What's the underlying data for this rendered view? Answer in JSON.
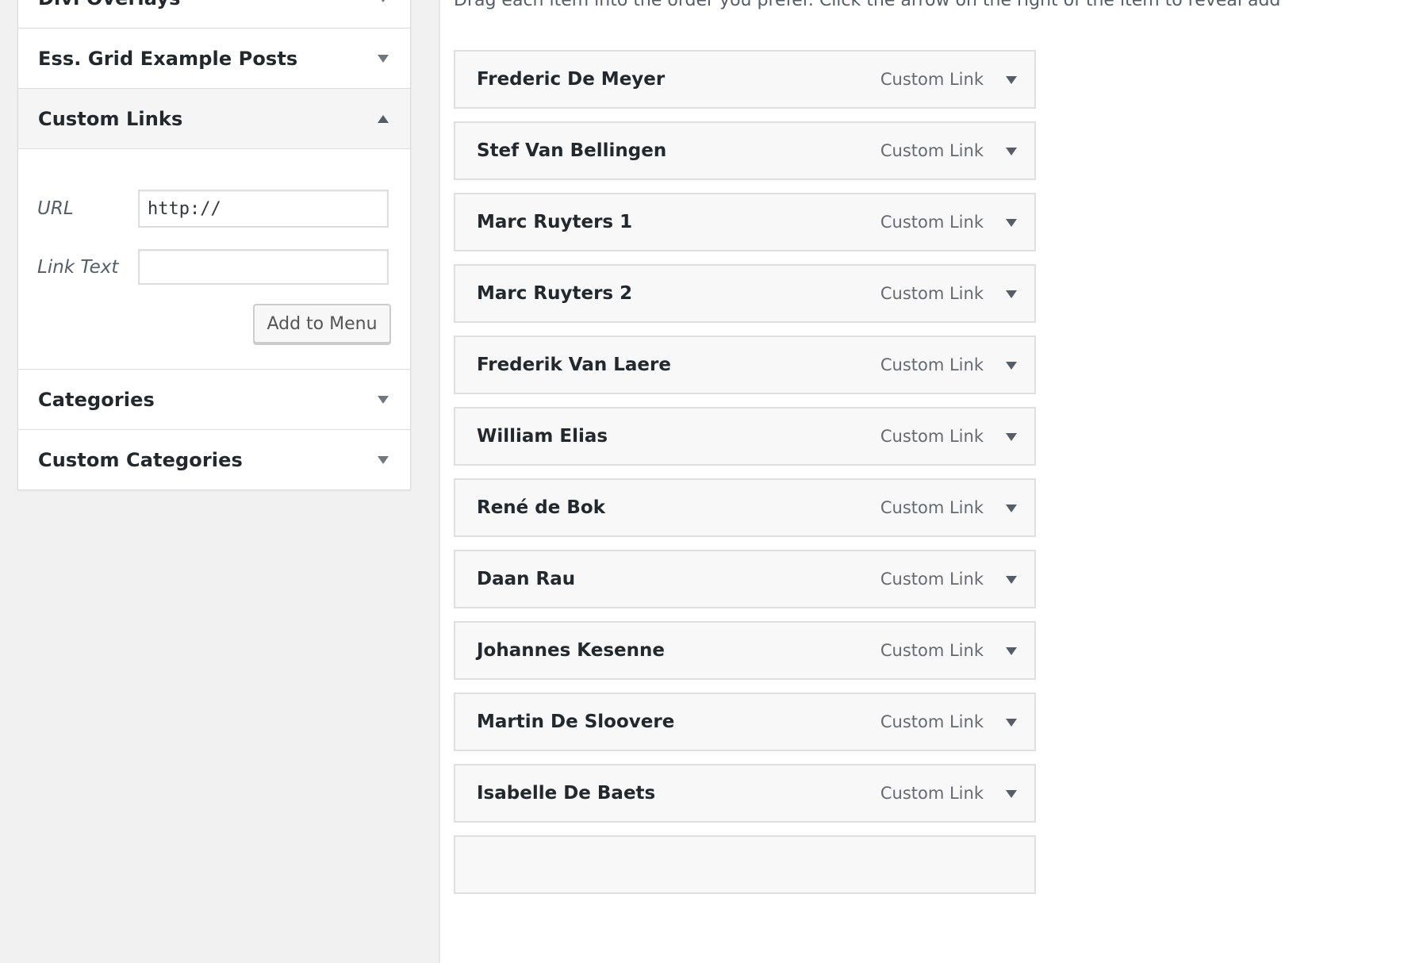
{
  "sidebar": {
    "sections": [
      {
        "title": "Divi Overlays",
        "open": false
      },
      {
        "title": "Ess. Grid Example Posts",
        "open": false
      },
      {
        "title": "Custom Links",
        "open": true
      },
      {
        "title": "Categories",
        "open": false
      },
      {
        "title": "Custom Categories",
        "open": false
      }
    ],
    "custom_links": {
      "url_label": "URL",
      "url_value": "http://",
      "link_text_label": "Link Text",
      "link_text_value": "",
      "add_button_label": "Add to Menu"
    }
  },
  "menu": {
    "instructions": "Drag each item into the order you prefer. Click the arrow on the right of the item to reveal add",
    "items": [
      {
        "title": "Frederic De Meyer",
        "type": "Custom Link"
      },
      {
        "title": "Stef Van Bellingen",
        "type": "Custom Link"
      },
      {
        "title": "Marc Ruyters 1",
        "type": "Custom Link"
      },
      {
        "title": "Marc Ruyters 2",
        "type": "Custom Link"
      },
      {
        "title": "Frederik Van Laere",
        "type": "Custom Link"
      },
      {
        "title": "William Elias",
        "type": "Custom Link"
      },
      {
        "title": "René de Bok",
        "type": "Custom Link"
      },
      {
        "title": "Daan Rau",
        "type": "Custom Link"
      },
      {
        "title": "Johannes Kesenne",
        "type": "Custom Link"
      },
      {
        "title": "Martin De Sloovere",
        "type": "Custom Link"
      },
      {
        "title": "Isabelle De Baets",
        "type": "Custom Link"
      },
      {
        "title": "",
        "type": ""
      }
    ]
  }
}
